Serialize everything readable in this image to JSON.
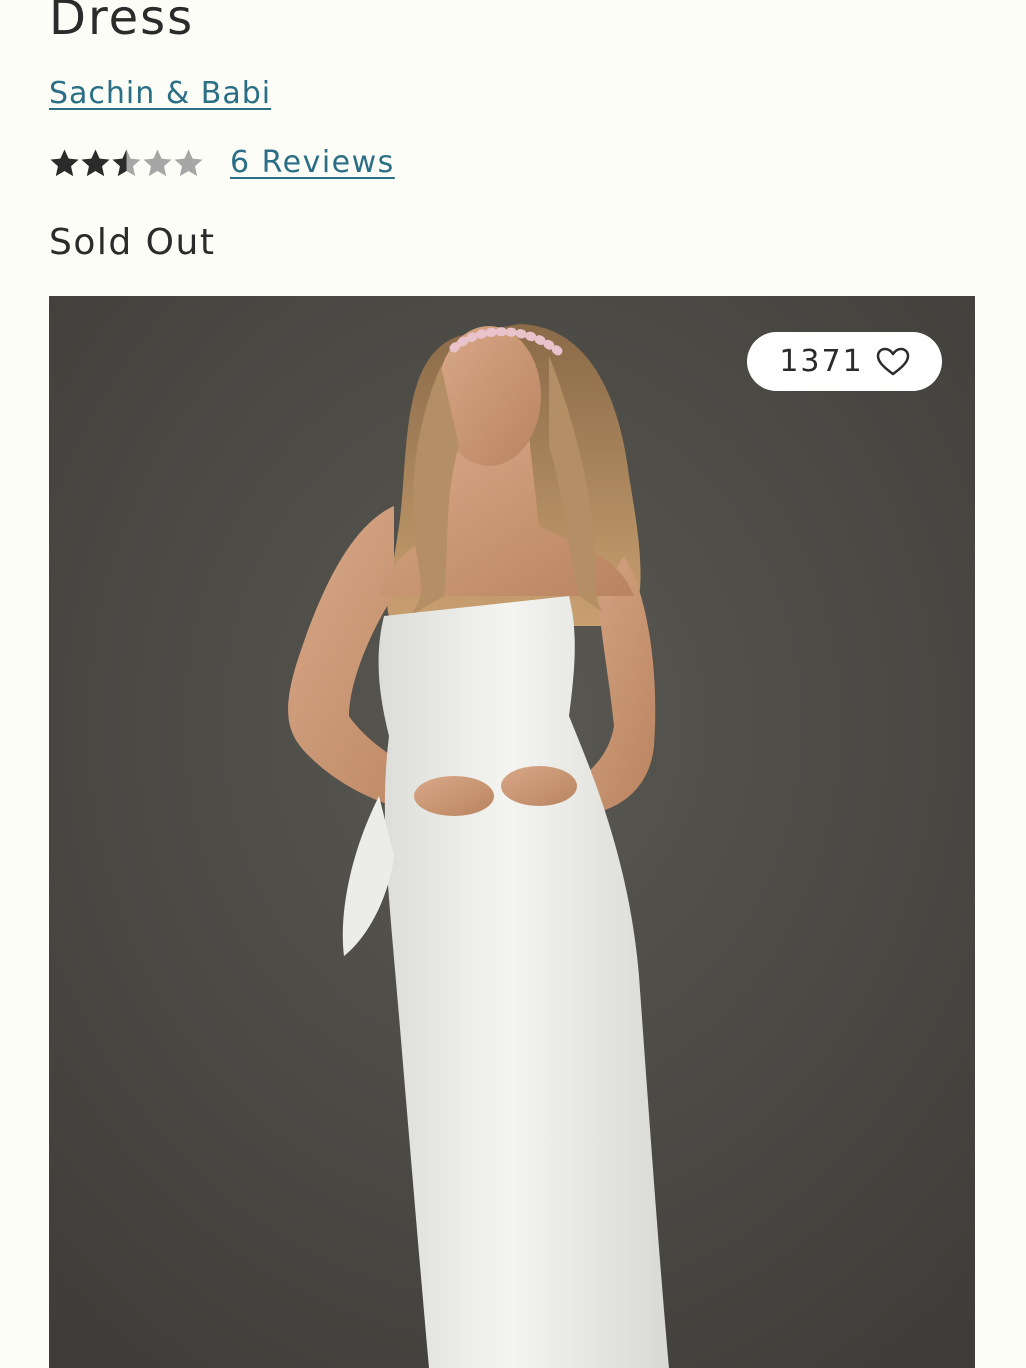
{
  "product": {
    "title": "Dress",
    "brand": "Sachin & Babi",
    "rating": {
      "value": 2.5,
      "max": 5,
      "filled_color": "#2b2b2b",
      "empty_color": "#a6a6a6"
    },
    "reviews_label": "6 Reviews",
    "status": "Sold Out"
  },
  "gallery": {
    "image_icon": "model-in-white-strapless-dress",
    "likes": {
      "count": "1371",
      "icon": "heart-icon"
    }
  },
  "colors": {
    "link": "#2a6f86",
    "text": "#2b2b2b",
    "background": "#fdfdf8"
  }
}
